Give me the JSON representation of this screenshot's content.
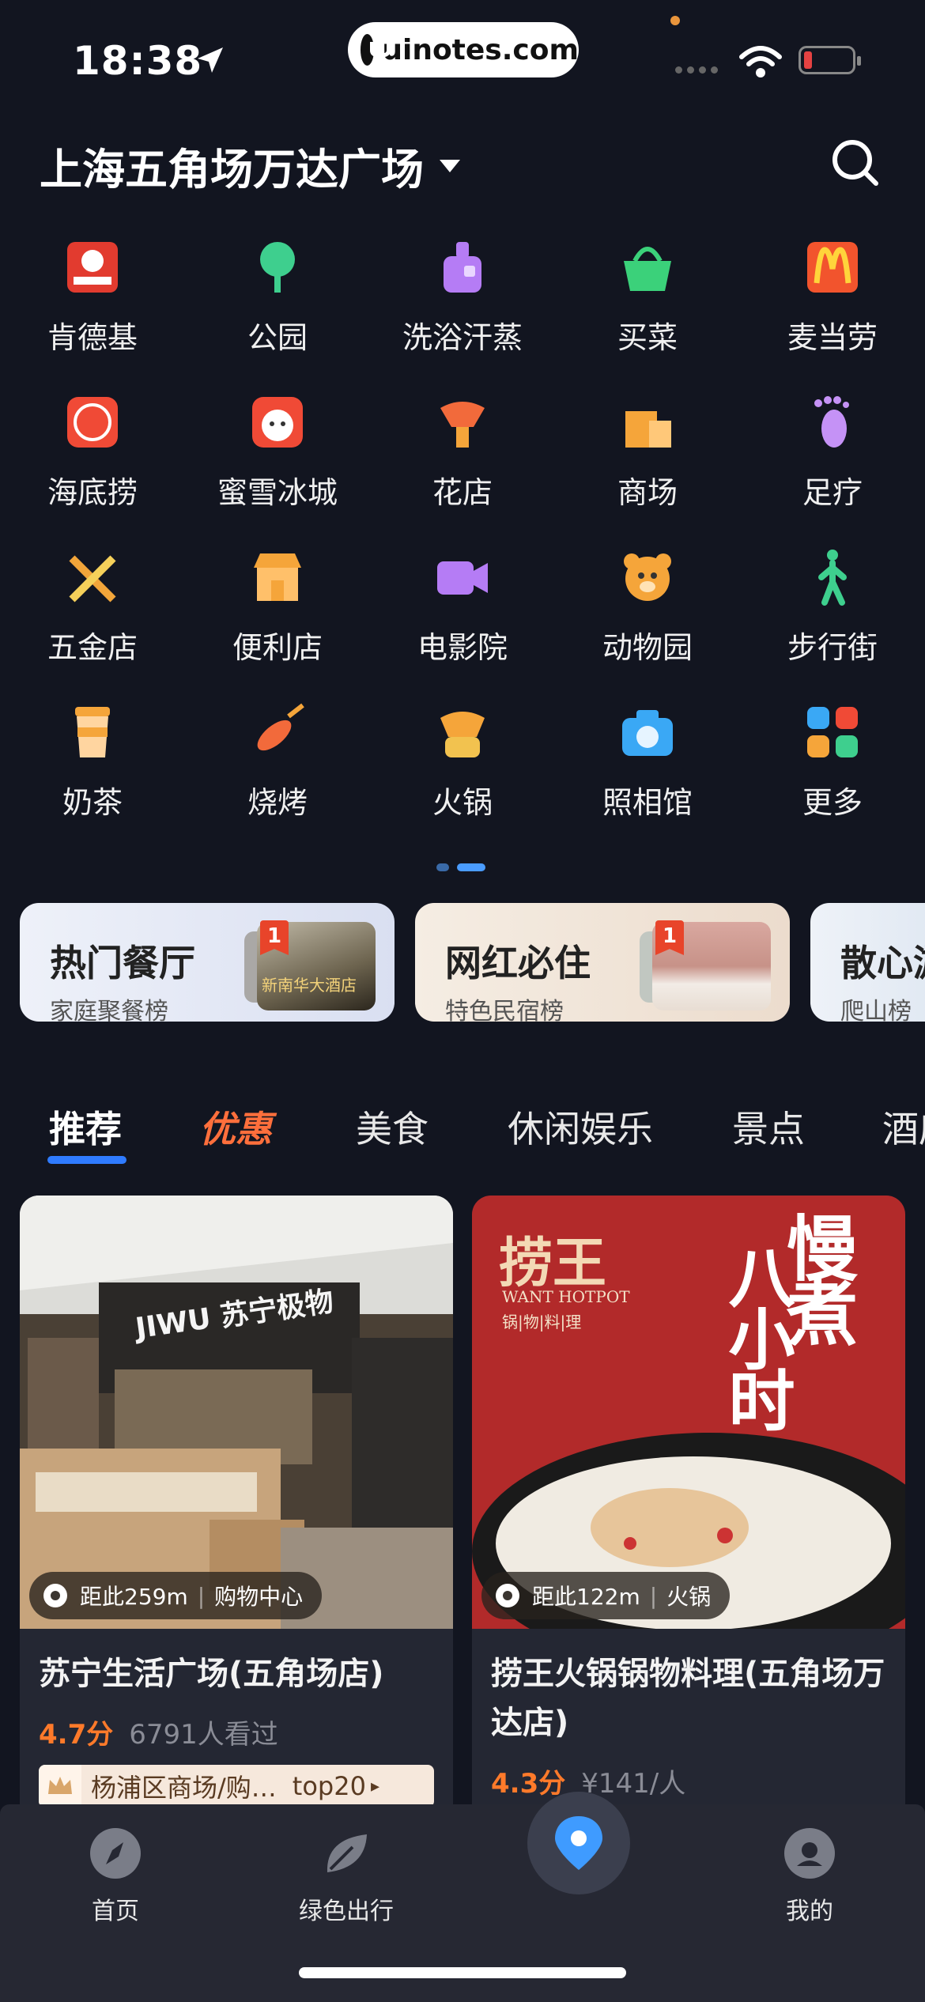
{
  "status_bar": {
    "time": "18:38",
    "watermark": "uinotes.com"
  },
  "header": {
    "location": "上海五角场万达广场"
  },
  "categories": [
    {
      "label": "肯德基",
      "icon": "kfc-icon",
      "color": "#e23b2f"
    },
    {
      "label": "公园",
      "icon": "tree-icon",
      "color": "#3ecf8e"
    },
    {
      "label": "洗浴汗蒸",
      "icon": "bath-icon",
      "color": "#b57cf5"
    },
    {
      "label": "买菜",
      "icon": "basket-icon",
      "color": "#3bd17a"
    },
    {
      "label": "麦当劳",
      "icon": "mcdonalds-icon",
      "color": "#f2542d"
    },
    {
      "label": "海底捞",
      "icon": "haidilao-icon",
      "color": "#f04a36"
    },
    {
      "label": "蜜雪冰城",
      "icon": "snowman-icon",
      "color": "#f04a36"
    },
    {
      "label": "花店",
      "icon": "flower-icon",
      "color": "#f26a3b"
    },
    {
      "label": "商场",
      "icon": "mall-icon",
      "color": "#f5a53a"
    },
    {
      "label": "足疗",
      "icon": "foot-icon",
      "color": "#c592f6"
    },
    {
      "label": "五金店",
      "icon": "tools-icon",
      "color": "#f2a53a"
    },
    {
      "label": "便利店",
      "icon": "store-icon",
      "color": "#f5a53a"
    },
    {
      "label": "电影院",
      "icon": "video-icon",
      "color": "#b57cf5"
    },
    {
      "label": "动物园",
      "icon": "bear-icon",
      "color": "#f5a53a"
    },
    {
      "label": "步行街",
      "icon": "walker-icon",
      "color": "#3ecf8e"
    },
    {
      "label": "奶茶",
      "icon": "milk-tea-icon",
      "color": "#f5a53a"
    },
    {
      "label": "烧烤",
      "icon": "bbq-icon",
      "color": "#f26a3b"
    },
    {
      "label": "火锅",
      "icon": "hotpot-icon",
      "color": "#f5a53a"
    },
    {
      "label": "照相馆",
      "icon": "camera-icon",
      "color": "#3aa8f5"
    },
    {
      "label": "更多",
      "icon": "more-grid-icon",
      "color": "#f5a53a"
    }
  ],
  "rank_cards": [
    {
      "title": "热门餐厅",
      "subtitle": "家庭聚餐榜",
      "badge": "1",
      "thumb_text": "新南华大酒店"
    },
    {
      "title": "网红必住",
      "subtitle": "特色民宿榜",
      "badge": "1"
    },
    {
      "title": "散心游",
      "subtitle": "爬山榜"
    }
  ],
  "tabs": [
    "推荐",
    "优惠",
    "美食",
    "休闲娱乐",
    "景点",
    "酒店"
  ],
  "feed": [
    {
      "distance": "距此259m",
      "category": "购物中心",
      "title": "苏宁生活广场(五角场店)",
      "score": "4.7分",
      "meta": "6791人看过",
      "rank_text": "杨浦区商场/购…",
      "rank_tag": "top20",
      "sign_text": "JIWU 苏宁极物"
    },
    {
      "distance": "距此122m",
      "category": "火锅",
      "title": "捞王火锅锅物料理(五角场万达店)",
      "score": "4.3分",
      "meta": "¥141/人",
      "brand": "捞王",
      "brand_en": "WANT HOTPOT",
      "brand_sub": "锅|物|料|理",
      "slogan_1": "慢煮",
      "slogan_2": "八小时"
    }
  ],
  "bottom_nav": [
    {
      "label": "首页",
      "icon": "compass-icon"
    },
    {
      "label": "绿色出行",
      "icon": "leaf-icon"
    },
    {
      "label": "",
      "icon": "map-pin-icon"
    },
    {
      "label": "我的",
      "icon": "profile-icon"
    }
  ]
}
